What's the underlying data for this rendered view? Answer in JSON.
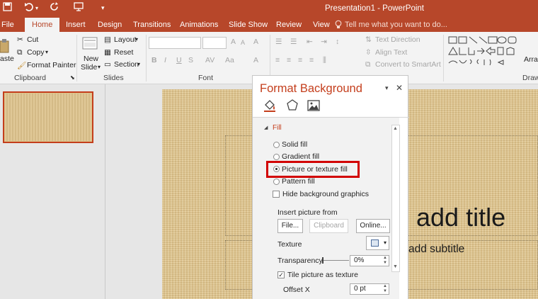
{
  "colors": {
    "accent": "#b7472a",
    "title_accent": "#c43e1c",
    "highlight": "#d20000"
  },
  "titlebar": {
    "title": "Presentation1 - PowerPoint",
    "icons": [
      "save-icon",
      "undo-icon",
      "redo-icon",
      "present-icon",
      "customize-qat-icon"
    ]
  },
  "tabs": [
    {
      "label": "File"
    },
    {
      "label": "Home",
      "active": true
    },
    {
      "label": "Insert"
    },
    {
      "label": "Design"
    },
    {
      "label": "Transitions"
    },
    {
      "label": "Animations"
    },
    {
      "label": "Slide Show"
    },
    {
      "label": "Review"
    },
    {
      "label": "View"
    }
  ],
  "tellme": "Tell me what you want to do...",
  "ribbon": {
    "clipboard": {
      "paste": "aste",
      "cut": "Cut",
      "copy": "Copy",
      "format_painter": "Format Painter",
      "label": "Clipboard"
    },
    "slides": {
      "new_slide_1": "New",
      "new_slide_2": "Slide",
      "layout": "Layout",
      "reset": "Reset",
      "section": "Section",
      "label": "Slides"
    },
    "font": {
      "label": "Font",
      "font_size_grow": "A",
      "font_size_shrink": "A",
      "bold": "B",
      "italic": "I",
      "underline": "U",
      "strike": "S",
      "char_spacing": "AV",
      "case": "Aa",
      "color": "A",
      "clear": "A"
    },
    "paragraph": {
      "text_direction": "Text Direction",
      "align_text": "Align Text",
      "convert_smartart": "Convert to SmartArt"
    },
    "drawing": {
      "arrange": "Arra",
      "label": "Draw"
    }
  },
  "pane": {
    "title": "Format Background",
    "fill_header": "Fill",
    "options": [
      {
        "label": "Solid fill",
        "checked": false
      },
      {
        "label": "Gradient fill",
        "checked": false
      },
      {
        "label": "Picture or texture fill",
        "checked": true
      },
      {
        "label": "Pattern fill",
        "checked": false
      }
    ],
    "hide_bg": "Hide background graphics",
    "insert_from": "Insert picture from",
    "file_btn": "File...",
    "clipboard_btn": "Clipboard",
    "online_btn": "Online...",
    "texture_label": "Texture",
    "transparency_label": "Transparency",
    "transparency_value": "0%",
    "tile_label": "Tile picture as texture",
    "offset_x_label": "Offset X",
    "offset_x_value": "0 pt"
  },
  "slide": {
    "title": "add title",
    "subtitle": "add subtitle"
  }
}
